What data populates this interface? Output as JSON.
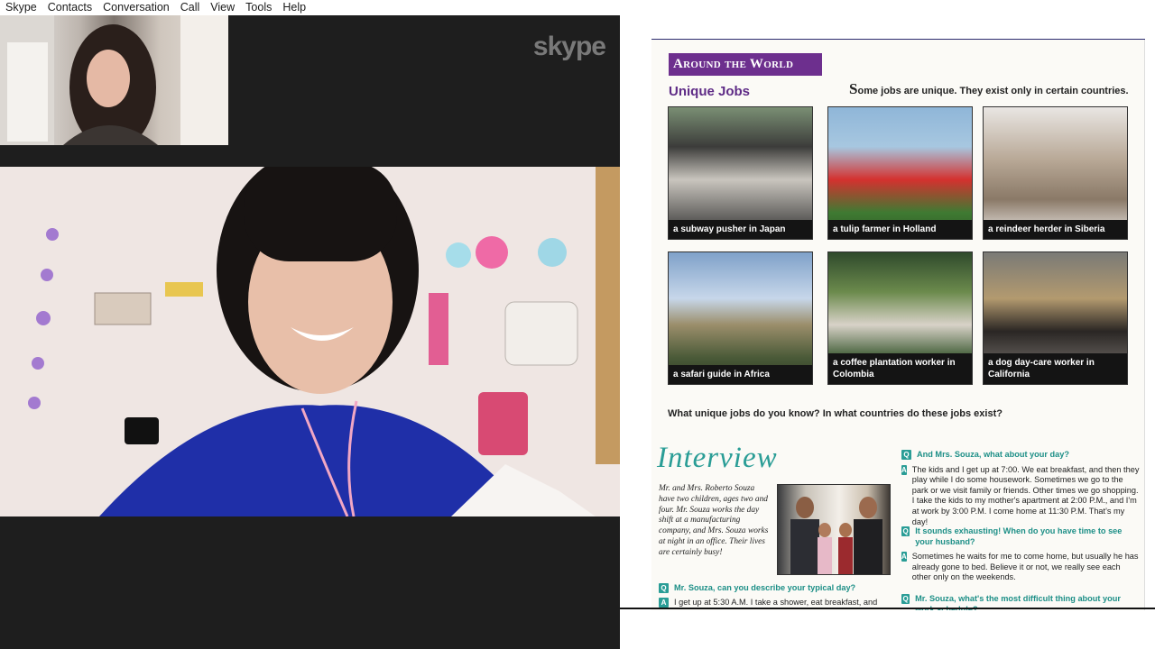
{
  "menu": [
    "Skype",
    "Contacts",
    "Conversation",
    "Call",
    "View",
    "Tools",
    "Help"
  ],
  "call": {
    "watermark": "skype",
    "brand_color": "#00aff0"
  },
  "doc": {
    "banner": "Around the World",
    "section_title": "Unique Jobs",
    "intro_dropcap": "S",
    "intro_rest": "ome jobs are unique.  They exist only in certain countries.",
    "photos": [
      "a subway pusher in Japan",
      "a tulip farmer in Holland",
      "a reindeer herder in Siberia",
      "a safari guide in Africa",
      "a coffee plantation worker in Colombia",
      "a dog day-care worker in California"
    ],
    "question": "What unique jobs do you know?  In what countries do these jobs exist?",
    "interview_title": "Interview",
    "bio": "Mr. and Mrs. Roberto Souza have two children, ages two and four.  Mr. Souza works the day shift at a manufacturing company, and Mrs. Souza works at night in an office. Their lives are certainly busy!",
    "q1": "Mr. Souza, can you describe your typical day?",
    "a1": "I get up at 5:30 A.M. I take a shower, eat breakfast, and",
    "q2": "And Mrs. Souza, what about your day?",
    "a2": "The kids and I get up at 7:00. We eat breakfast, and then they play while I do some housework. Sometimes we go to the park or we visit family or friends. Other times we go shopping. I take the kids to my mother's apartment at 2:00 P.M., and I'm at work by 3:00 P.M. I come home at 11:30 P.M. That's my day!",
    "q3": "It sounds exhausting! When do you have time to see your husband?",
    "a3": "Sometimes he waits for me to come home, but usually he has already gone to bed. Believe it or not, we really see each other only on the weekends.",
    "q4": "Mr. Souza, what's the most difficult thing about your work schedule?",
    "badge_q": "Q",
    "badge_a": "A"
  }
}
